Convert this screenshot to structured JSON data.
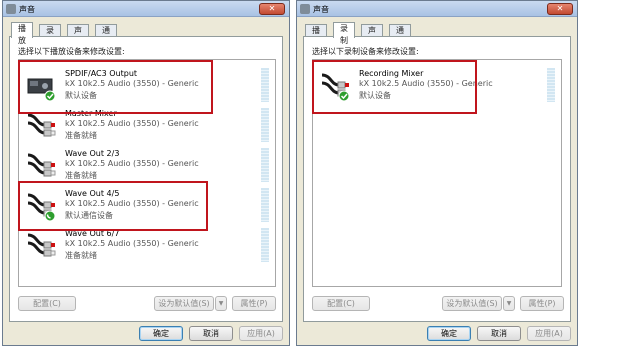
{
  "colors": {
    "highlight": "#c0151d",
    "title_bar": "#b9cfeb",
    "meter": "#d2e6f2",
    "check_green": "#2e9e2e"
  },
  "left": {
    "title": "声音",
    "tabs": [
      "播放",
      "录制",
      "声音",
      "通信"
    ],
    "instruction": "选择以下播放设备来修改设置:",
    "devices": [
      {
        "name": "SPDIF/AC3 Output",
        "desc": "kX 10k2.5 Audio (3550) - Generic",
        "status": "默认设备",
        "icon": "digital-output-icon",
        "badge": "check"
      },
      {
        "name": "Master Mixer",
        "desc": "kX 10k2.5 Audio (3550) - Generic",
        "status": "准备就绪",
        "icon": "rca-cable-icon",
        "badge": ""
      },
      {
        "name": "Wave Out 2/3",
        "desc": "kX 10k2.5 Audio (3550) - Generic",
        "status": "准备就绪",
        "icon": "rca-cable-icon",
        "badge": ""
      },
      {
        "name": "Wave Out 4/5",
        "desc": "kX 10k2.5 Audio (3550) - Generic",
        "status": "默认通信设备",
        "icon": "rca-cable-icon",
        "badge": "phone"
      },
      {
        "name": "Wave Out 6/7",
        "desc": "kX 10k2.5 Audio (3550) - Generic",
        "status": "准备就绪",
        "icon": "rca-cable-icon",
        "badge": ""
      }
    ],
    "buttons": {
      "configure": "配置(C)",
      "set_default": "设为默认值(S)",
      "properties": "属性(P)",
      "ok": "确定",
      "cancel": "取消",
      "apply": "应用(A)"
    }
  },
  "right": {
    "title": "声音",
    "tabs": [
      "播放",
      "录制",
      "声音",
      "通信"
    ],
    "instruction": "选择以下录制设备来修改设置:",
    "devices": [
      {
        "name": "Recording Mixer",
        "desc": "kX 10k2.5 Audio (3550) - Generic",
        "status": "默认设备",
        "icon": "rca-cable-icon",
        "badge": "check"
      }
    ],
    "buttons": {
      "configure": "配置(C)",
      "set_default": "设为默认值(S)",
      "properties": "属性(P)",
      "ok": "确定",
      "cancel": "取消",
      "apply": "应用(A)"
    }
  }
}
